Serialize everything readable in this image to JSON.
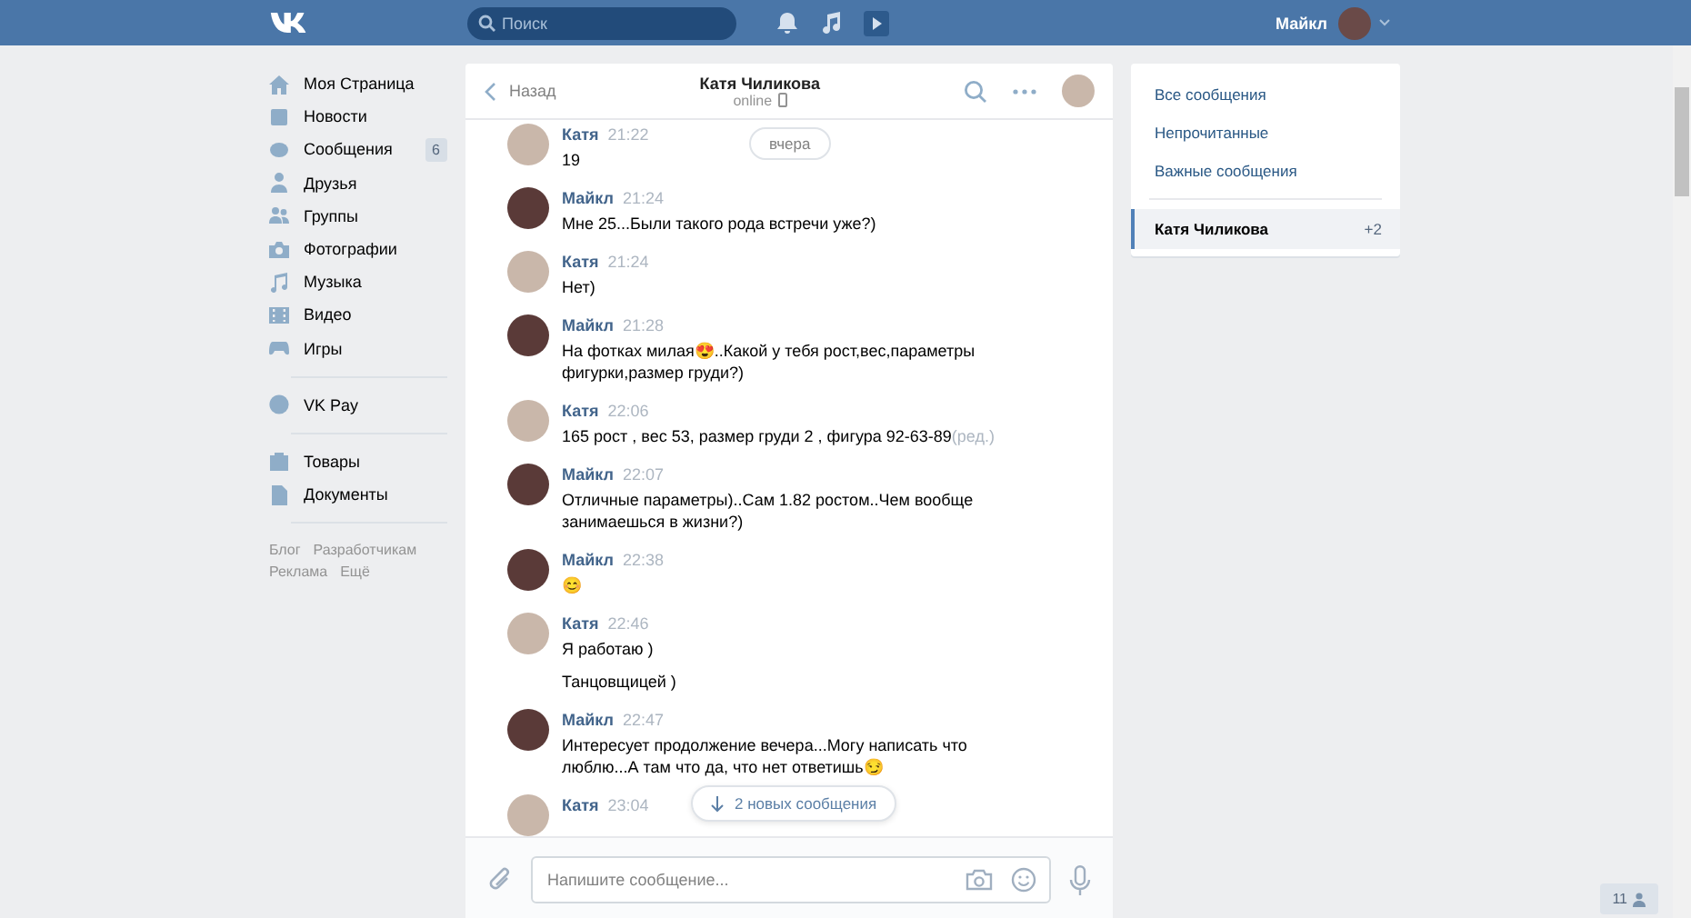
{
  "header": {
    "search": {
      "placeholder": "Поиск"
    },
    "user_name": "Майкл"
  },
  "nav": {
    "groups": [
      [
        {
          "label": "Моя Страница"
        },
        {
          "label": "Новости"
        },
        {
          "label": "Сообщения",
          "badge": "6"
        },
        {
          "label": "Друзья"
        },
        {
          "label": "Группы"
        },
        {
          "label": "Фотографии"
        },
        {
          "label": "Музыка"
        },
        {
          "label": "Видео"
        },
        {
          "label": "Игры"
        }
      ],
      [
        {
          "label": "VK Pay"
        }
      ],
      [
        {
          "label": "Товары"
        },
        {
          "label": "Документы"
        }
      ]
    ],
    "footer_links": [
      "Блог",
      "Разработчикам",
      "Реклама",
      "Ещё"
    ]
  },
  "chat": {
    "back": "Назад",
    "title": "Катя Чиликова",
    "status": "online",
    "date_pill": "вчера",
    "messages": [
      {
        "author": "Катя",
        "outgoing": false,
        "time": "21:22",
        "texts": [
          "19"
        ]
      },
      {
        "author": "Майкл",
        "outgoing": true,
        "time": "21:24",
        "texts": [
          "Мне 25...Были такого рода встречи уже?)"
        ]
      },
      {
        "author": "Катя",
        "outgoing": false,
        "time": "21:24",
        "texts": [
          "Нет)"
        ]
      },
      {
        "author": "Майкл",
        "outgoing": true,
        "time": "21:28",
        "texts": [
          "На фотках милая😍..Какой у тебя рост,вес,параметры фигурки,размер груди?)"
        ]
      },
      {
        "author": "Катя",
        "outgoing": false,
        "time": "22:06",
        "texts": [
          "165 рост , вес 53, размер груди 2 , фигура 92-63-89"
        ],
        "edited": "(ред.)"
      },
      {
        "author": "Майкл",
        "outgoing": true,
        "time": "22:07",
        "texts": [
          "Отличные параметры)..Сам 1.82 ростом..Чем вообще занимаешься в жизни?)"
        ]
      },
      {
        "author": "Майкл",
        "outgoing": true,
        "time": "22:38",
        "texts": [
          "😊"
        ]
      },
      {
        "author": "Катя",
        "outgoing": false,
        "time": "22:46",
        "texts": [
          "Я работаю )",
          "Танцовщицей )"
        ]
      },
      {
        "author": "Майкл",
        "outgoing": true,
        "time": "22:47",
        "texts": [
          "Интересует продолжение вечера...Могу написать что люблю...А там что да, что нет ответишь😏"
        ]
      },
      {
        "author": "Катя",
        "outgoing": false,
        "time": "23:04"
      }
    ],
    "new_messages": "2 новых сообщения",
    "composer": {
      "placeholder": "Напишите сообщение..."
    }
  },
  "folders": {
    "items": [
      {
        "label": "Все сообщения",
        "selected": false
      },
      {
        "label": "Непрочитанные",
        "selected": false
      },
      {
        "label": "Важные сообщения",
        "selected": false
      }
    ],
    "conversations": [
      {
        "label": "Катя Чиликова",
        "count": "+2",
        "selected": true
      }
    ]
  },
  "online_counter": "11"
}
